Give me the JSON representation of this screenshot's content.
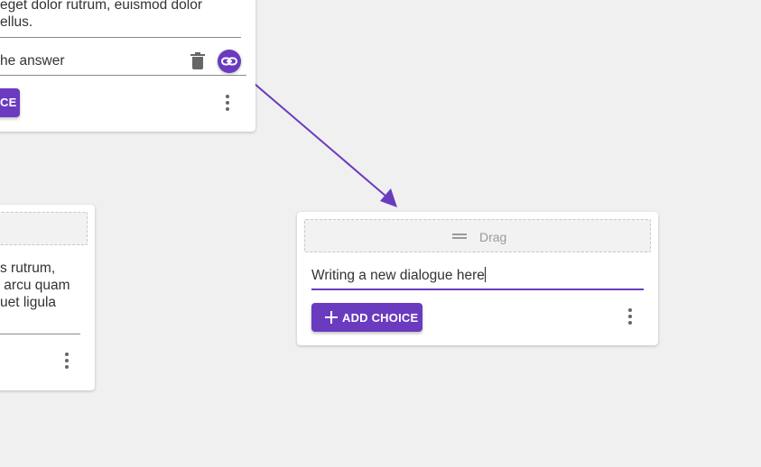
{
  "card_top": {
    "text_line1": "eget dolor rutrum, euismod dolor",
    "text_line2": "ellus.",
    "choice_text": "he answer",
    "button_label_fragment": "CE"
  },
  "card_left": {
    "text_line1": "s rutrum,",
    "text_line2": " arcu quam",
    "text_line3": "uet ligula"
  },
  "card_main": {
    "drag_label": "Drag",
    "input_value": "Writing a new dialogue here",
    "add_choice_label": "ADD CHOICE"
  },
  "colors": {
    "accent": "#6a3bbf",
    "background": "#f0f0f0"
  }
}
